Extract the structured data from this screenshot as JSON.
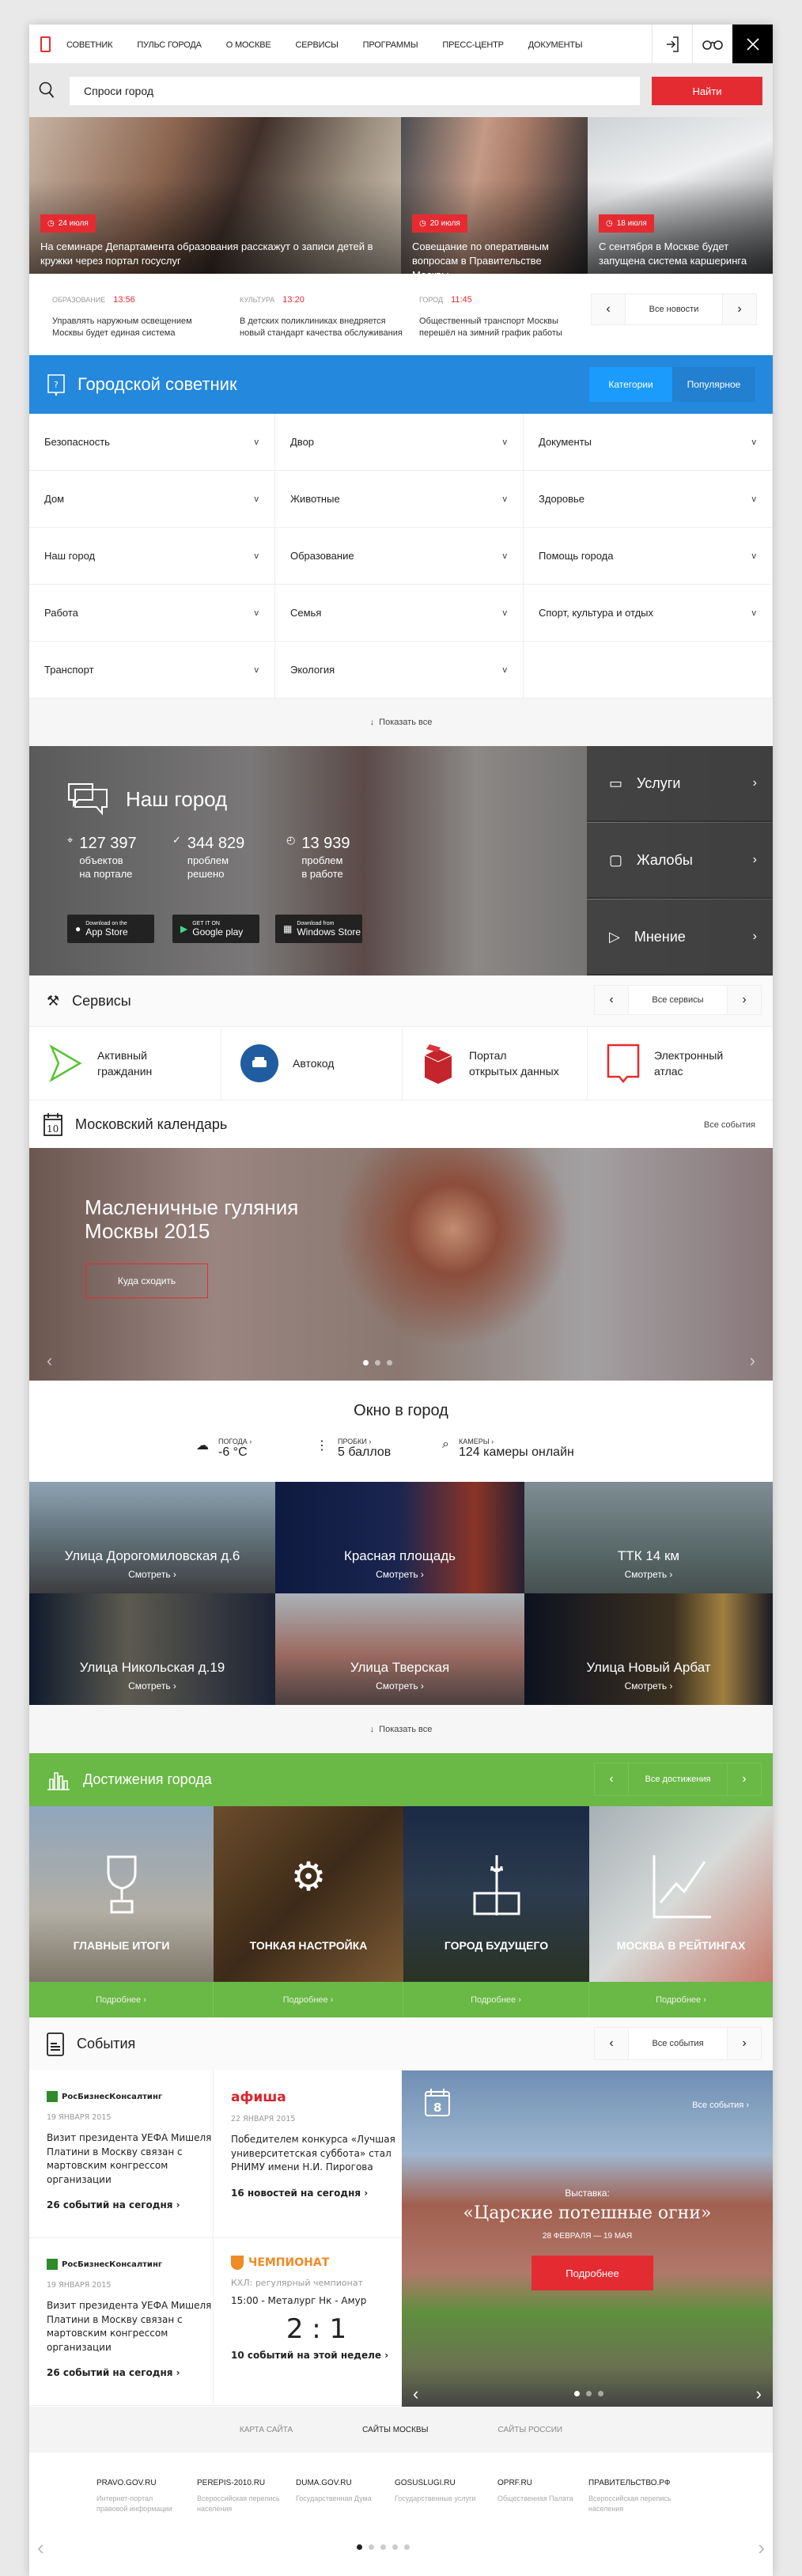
{
  "colors": {
    "accent_red": "#e52b32",
    "advisor_blue": "#2488dd",
    "achievements_green": "#6ab845"
  },
  "header": {
    "nav": [
      "СОВЕТНИК",
      "ПУЛЬС ГОРОДА",
      "О МОСКВЕ",
      "СЕРВИСЫ",
      "ПРОГРАММЫ",
      "ПРЕСС-ЦЕНТР",
      "ДОКУМЕНТЫ"
    ],
    "icons": [
      "login-icon",
      "glasses-icon",
      "close-icon"
    ]
  },
  "search": {
    "value": "Спроси город",
    "button": "Найти"
  },
  "hero": [
    {
      "date": "24 июля",
      "title": "На семинаре Департамента образования расскажут о записи детей в кружки через портал госуслуг"
    },
    {
      "date": "20 июля",
      "title": "Совещание по оперативным вопросам в Правительстве Москвы"
    },
    {
      "date": "18 июля",
      "title": "С сентября в Москве будет запущена система каршеринга"
    }
  ],
  "news": {
    "items": [
      {
        "category": "Образование",
        "time": "13:56",
        "text": "Управлять наружным освещением Москвы будет единая система"
      },
      {
        "category": "Культура",
        "time": "13:20",
        "text": "В детских поликлиниках внедряется новый стандарт качества обслуживания"
      },
      {
        "category": "Город",
        "time": "11:45",
        "text": "Общественный транспорт Москвы перешёл на зимний график работы"
      }
    ],
    "all": "Все новости"
  },
  "advisor": {
    "title": "Городской советник",
    "tabs": [
      "Категории",
      "Популярное"
    ],
    "active_tab": "Категории",
    "categories": [
      "Безопасность",
      "Двор",
      "Документы",
      "Дом",
      "Животные",
      "Здоровье",
      "Наш город",
      "Образование",
      "Помощь города",
      "Работа",
      "Семья",
      "Спорт, культура и отдых",
      "Транспорт",
      "Экология"
    ],
    "show_all": "Показать все"
  },
  "city": {
    "title": "Наш город",
    "stats": [
      {
        "value": "127 397",
        "l1": "объектов",
        "l2": "на портале"
      },
      {
        "value": "344 829",
        "l1": "проблем",
        "l2": "решено"
      },
      {
        "value": "13 939",
        "l1": "проблем",
        "l2": "в работе"
      }
    ],
    "stores": [
      {
        "small": "Download on the",
        "big": "App Store"
      },
      {
        "small": "GET IT ON",
        "big": "Google play"
      },
      {
        "small": "Download from",
        "big": "Windows Store"
      }
    ],
    "side": [
      "Услуги",
      "Жалобы",
      "Мнение"
    ]
  },
  "services": {
    "title": "Сервисы",
    "all": "Все сервисы",
    "items": [
      {
        "l1": "Активный",
        "l2": "гражданин"
      },
      {
        "l1": "Автокод",
        "l2": ""
      },
      {
        "l1": "Портал",
        "l2": "открытых данных"
      },
      {
        "l1": "Электронный",
        "l2": "атлас"
      }
    ]
  },
  "calendar": {
    "title": "Московский календарь",
    "all": "Все события",
    "day": "10",
    "slide_title": "Масленичные гуляния Москвы 2015",
    "button": "Куда сходить",
    "slide_count": 3,
    "active_slide": 1
  },
  "okno": {
    "title": "Окно в город",
    "items": [
      {
        "label": "ПОГОДА ›",
        "value": "-6 °C"
      },
      {
        "label": "ПРОБКИ ›",
        "value": "5 баллов"
      },
      {
        "label": "КАМЕРЫ ›",
        "value": "124 камеры онлайн"
      }
    ],
    "cams": [
      "Улица  Дорогомиловская д.6",
      "Красная площадь",
      "ТТК 14 км",
      "Улица  Никольская д.19",
      "Улица Тверская",
      "Улица Новый Арбат"
    ],
    "watch": "Смотреть ›",
    "show_all": "Показать все"
  },
  "achievements": {
    "title": "Достижения города",
    "all": "Все достижения",
    "tiles": [
      "ГЛАВНЫЕ ИТОГИ",
      "ТОНКАЯ НАСТРОЙКА",
      "ГОРОД БУДУЩЕГО",
      "МОСКВА В РЕЙТИНГАХ"
    ],
    "more": "Подробнее ›"
  },
  "events": {
    "title": "События",
    "all": "Все события",
    "cards": [
      {
        "source": "РосБизнесКонсалтинг",
        "date": "19 ЯНВАРЯ 2015",
        "text": "Визит президента УЕФА Мишеля Платини в Москву связан с мартовским конгрессом организации",
        "more": "26 событий на сегодня ›"
      },
      {
        "source": "афиша",
        "date": "22 ЯНВАРЯ 2015",
        "text": "Победителем конкурса «Лучшая университетская суббота» стал РНИМУ имени Н.И. Пирогова",
        "more": "16 новостей на сегодня ›"
      },
      {
        "source": "РосБизнесКонсалтинг",
        "date": "19 ЯНВАРЯ 2015",
        "text": "Визит президента УЕФА Мишеля Платини в Москву связан с мартовским конгрессом организации",
        "more": "26 событий на сегодня ›"
      },
      {
        "source": "ЧЕМПИОНАТ",
        "date": "КХЛ: регулярный чемпионат",
        "text": "15:00 - Металург Нк - Амур",
        "score": "2 : 1",
        "more": "10 событий на этой неделе ›"
      }
    ],
    "feature": {
      "day": "8",
      "all": "Все события ›",
      "kind": "Выставка:",
      "title": "«Царские потешные огни»",
      "dates": "28 ФЕВРАЛЯ — 19 МАЯ",
      "button": "Подробнее",
      "slide_count": 3,
      "active_slide": 1
    }
  },
  "footer": {
    "tabs": [
      "КАРТА САЙТА",
      "САЙТЫ МОСКВЫ",
      "САЙТЫ РОССИИ"
    ],
    "active_tab": "САЙТЫ МОСКВЫ",
    "links": [
      {
        "name": "PRAVO.GOV.RU",
        "desc": "Интернет-портал правовой информации"
      },
      {
        "name": "PEREPIS-2010.RU",
        "desc": "Всероссийская перепись населения"
      },
      {
        "name": "DUMA.GOV.RU",
        "desc": "Государственная Дума"
      },
      {
        "name": "GOSUSLUGI.RU",
        "desc": "Государственные услуги"
      },
      {
        "name": "OPRF.RU",
        "desc": "Общественная Палата"
      },
      {
        "name": "ПРАВИТЕЛЬСТВО.РФ",
        "desc": "Всероссийская перепись населения"
      }
    ],
    "page_count": 5,
    "active_page": 1
  }
}
